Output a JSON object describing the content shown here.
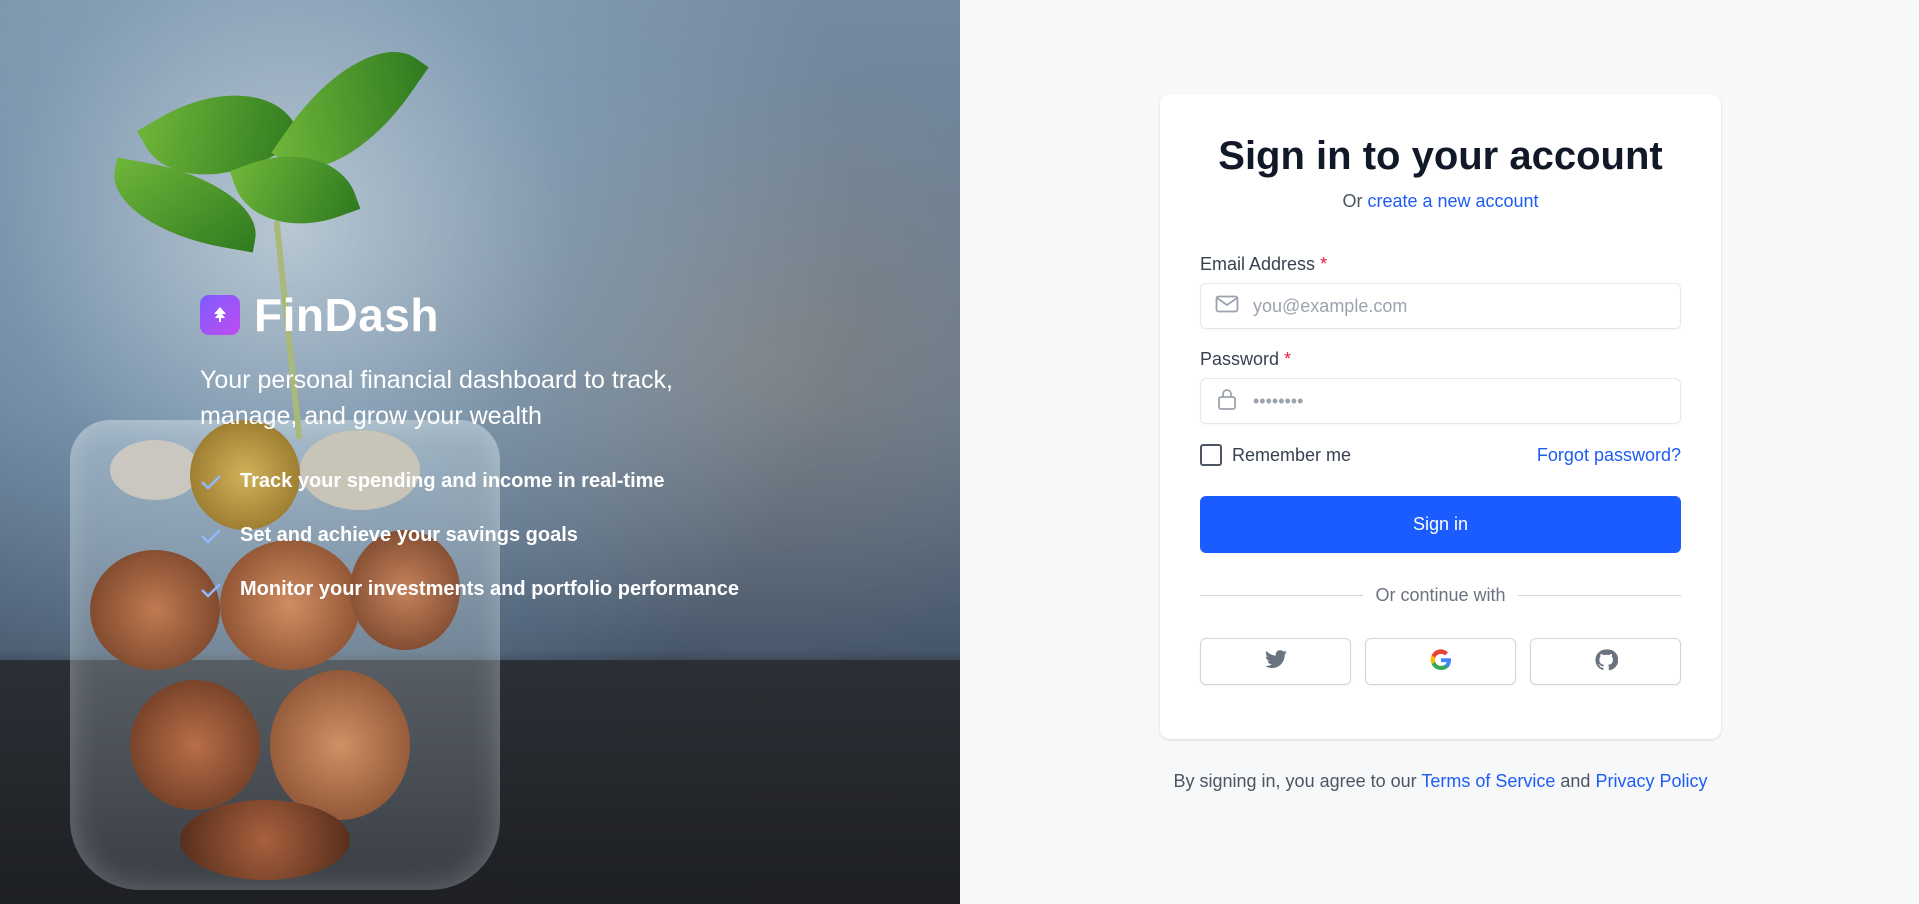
{
  "brand": {
    "name": "FinDash",
    "tagline": "Your personal financial dashboard to track, manage, and grow your wealth",
    "features": [
      "Track your spending and income in real-time",
      "Set and achieve your savings goals",
      "Monitor your investments and portfolio performance"
    ]
  },
  "form": {
    "title": "Sign in to your account",
    "subtitle_prefix": "Or",
    "create_account_link": "create a new account",
    "email_label": "Email Address",
    "email_placeholder": "you@example.com",
    "password_label": "Password",
    "password_placeholder": "••••••••",
    "required_mark": "*",
    "remember_label": "Remember me",
    "forgot_link": "Forgot password?",
    "signin_button": "Sign in",
    "divider_text": "Or continue with",
    "social_providers": [
      "twitter-icon",
      "google-icon",
      "github-icon"
    ]
  },
  "terms": {
    "prefix": "By signing in, you agree to our",
    "tos_link": "Terms of Service",
    "and": "and",
    "privacy_link": "Privacy Policy"
  },
  "colors": {
    "primary": "#1a5cff",
    "link": "#1d5cf5",
    "required": "#e11d48"
  }
}
